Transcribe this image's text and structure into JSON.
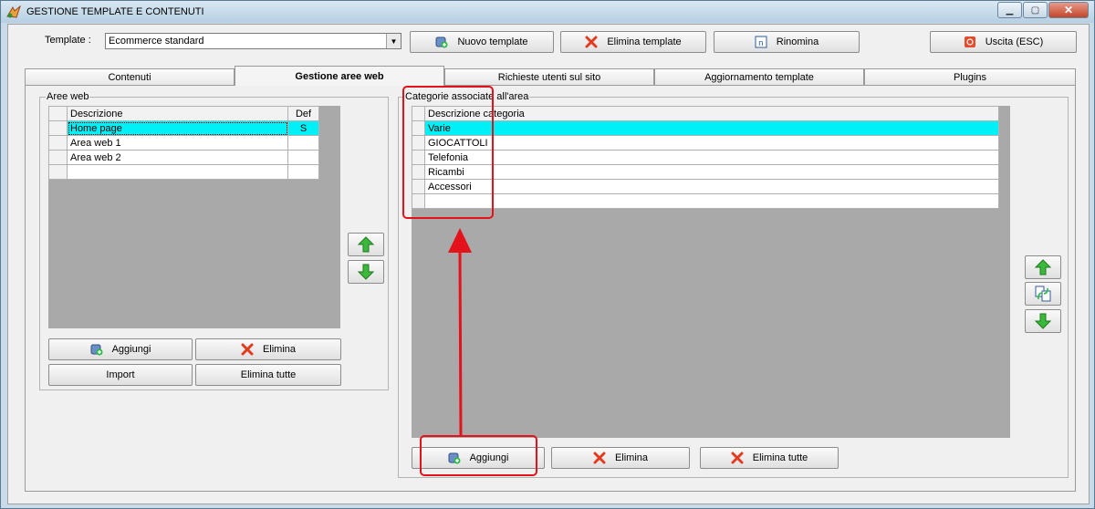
{
  "window": {
    "title": "GESTIONE TEMPLATE E CONTENUTI",
    "controls": [
      "minimize-icon",
      "maximize-icon",
      "close-icon"
    ]
  },
  "toolbar": {
    "template_label": "Template :",
    "template_value": "Ecommerce standard",
    "new_template": "Nuovo template",
    "delete_template": "Elimina template",
    "rename": "Rinomina",
    "exit": "Uscita (ESC)"
  },
  "tabs": [
    {
      "label": "Contenuti",
      "active": false
    },
    {
      "label": "Gestione aree web",
      "active": true
    },
    {
      "label": "Richieste utenti sul sito",
      "active": false
    },
    {
      "label": "Aggiornamento template",
      "active": false
    },
    {
      "label": "Plugins",
      "active": false
    }
  ],
  "aree_web": {
    "title": "Aree web",
    "columns": [
      "Descrizione",
      "Def"
    ],
    "rows": [
      {
        "descrizione": "Home page",
        "def": "S",
        "selected": true
      },
      {
        "descrizione": "Area web 1",
        "def": "",
        "selected": false
      },
      {
        "descrizione": "Area web 2",
        "def": "",
        "selected": false
      }
    ],
    "add_label": "Aggiungi",
    "delete_label": "Elimina",
    "import_label": "Import",
    "delete_all_label": "Elimina tutte"
  },
  "categorie": {
    "title": "Categorie associate all'area",
    "columns": [
      "Descrizione categoria"
    ],
    "rows": [
      {
        "descrizione": "Varie",
        "selected": true
      },
      {
        "descrizione": "GIOCATTOLI",
        "selected": false
      },
      {
        "descrizione": "Telefonia",
        "selected": false
      },
      {
        "descrizione": "Ricambi",
        "selected": false
      },
      {
        "descrizione": "Accessori",
        "selected": false
      }
    ],
    "add_label": "Aggiungi",
    "delete_label": "Elimina",
    "delete_all_label": "Elimina tutte"
  },
  "colors": {
    "selected_row": "#00f0f8",
    "annotation": "#e3121b",
    "arrow_green": "#3cb83c"
  }
}
